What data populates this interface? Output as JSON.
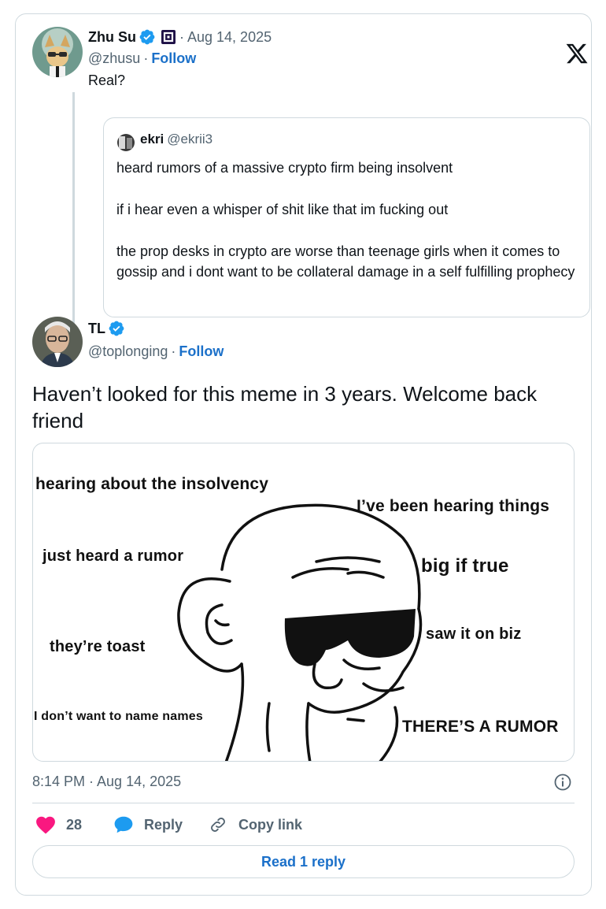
{
  "parent_tweet": {
    "display_name": "Zhu Su",
    "date": "Aug 14, 2025",
    "handle": "@zhusu",
    "follow_label": "Follow",
    "text": "Real?",
    "separator": "·"
  },
  "quoted_tweet": {
    "display_name": "ekri",
    "handle": "@ekrii3",
    "lines": [
      "heard rumors of a massive crypto firm being insolvent",
      "if i hear even a whisper of shit like that im fucking out",
      "the prop desks in crypto are worse than teenage girls when it comes to gossip and i dont want to be collateral damage in a self fulfilling prophecy"
    ]
  },
  "main_tweet": {
    "display_name": "TL",
    "handle": "@toplonging",
    "follow_label": "Follow",
    "separator": "·",
    "text": "Haven’t looked for this meme in 3 years. Welcome back friend",
    "meme_labels": [
      "hearing about the insolvency",
      "I’ve been hearing things",
      "just heard a rumor",
      "big if true",
      "saw it on biz",
      "they’re toast",
      "I don’t want to name names",
      "THERE’S A RUMOR"
    ],
    "timestamp": "8:14 PM · Aug 14, 2025"
  },
  "actions": {
    "like_count": "28",
    "reply_label": "Reply",
    "copy_label": "Copy link"
  },
  "read_reply_label": "Read 1 reply",
  "colors": {
    "accent": "#1d9bf0",
    "link": "#1b70c9",
    "like": "#f91880",
    "border": "#cfd9de",
    "secondary_text": "#536471"
  },
  "icons": [
    "verified-badge-icon",
    "org-badge-icon",
    "x-logo-icon",
    "info-icon",
    "heart-icon",
    "reply-bubble-icon",
    "link-icon"
  ]
}
